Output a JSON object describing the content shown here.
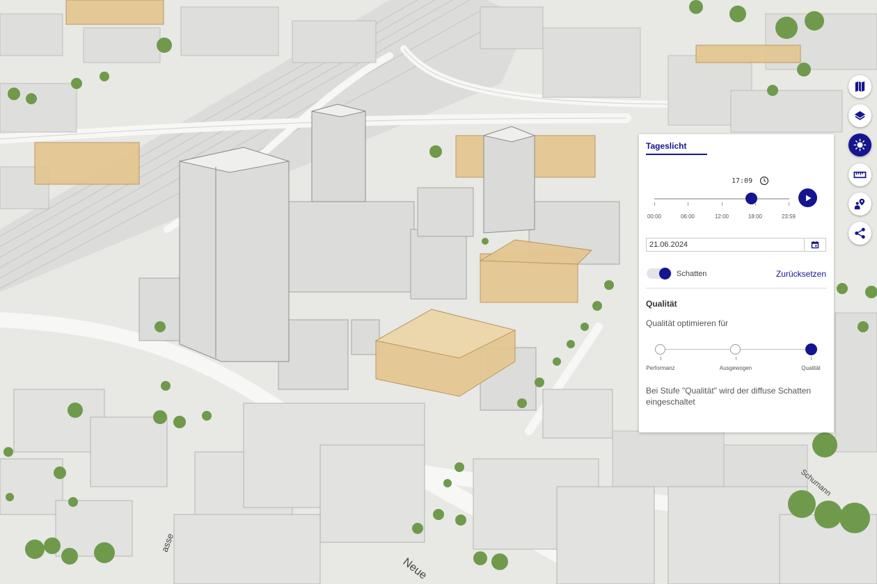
{
  "map": {
    "street_labels": [
      "Neue",
      "asse",
      "Schumann"
    ]
  },
  "toolbar": {
    "buttons": [
      {
        "name": "map-icon",
        "active": false
      },
      {
        "name": "layers-icon",
        "active": false
      },
      {
        "name": "sun-icon",
        "active": true
      },
      {
        "name": "ruler-icon",
        "active": false
      },
      {
        "name": "location-person-icon",
        "active": false
      },
      {
        "name": "share-icon",
        "active": false
      }
    ]
  },
  "panel": {
    "tab_label": "Tageslicht",
    "time_value": "17:09",
    "time_fraction": 0.7146,
    "time_ticks": [
      "00:00",
      "06:00",
      "12:00",
      "18:00",
      "23:59"
    ],
    "date_value": "21.06.2024",
    "shadow_label": "Schatten",
    "shadow_enabled": true,
    "reset_label": "Zurücksetzen",
    "quality_title": "Qualität",
    "quality_subtitle": "Qualität optimieren für",
    "quality_options": [
      "Performanz",
      "Ausgewogen",
      "Qualität"
    ],
    "quality_selected": 2,
    "quality_info": "Bei Stufe \"Qualität\" wird der diffuse Schatten eingeschaltet"
  },
  "colors": {
    "accent": "#15158f",
    "highlight_building": "#e2c48c",
    "building": "#d9d9d9",
    "tree": "#6f9a4c"
  }
}
